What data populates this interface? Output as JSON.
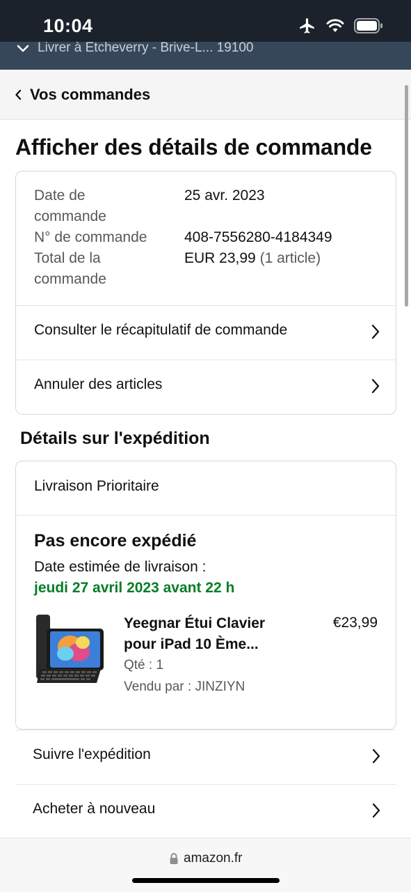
{
  "status_bar": {
    "time": "10:04"
  },
  "delivery_strip": {
    "text": "Livrer à Etcheverry - Brive-L... 19100"
  },
  "nav": {
    "back_label": "Vos commandes"
  },
  "page": {
    "title": "Afficher des détails de commande"
  },
  "order_summary": {
    "date_label_line1": "Date de",
    "date_label_line2": "commande",
    "date_value": "25 avr. 2023",
    "number_label": "N° de commande",
    "number_value": "408-7556280-4184349",
    "total_label_line1": "Total de la",
    "total_label_line2": "commande",
    "total_value": "EUR 23,99",
    "total_items": "(1 article)"
  },
  "summary_links": {
    "recap": "Consulter le récapitulatif de commande",
    "cancel": "Annuler des articles"
  },
  "shipment": {
    "section_title": "Détails sur l'expédition",
    "method": "Livraison Prioritaire",
    "status": "Pas encore expédié",
    "estimate_label": "Date estimée de livraison :",
    "estimate_date": "jeudi 27 avril 2023 avant 22 h",
    "product": {
      "title_line1": "Yeegnar Étui Clavier",
      "title_line2": "pour iPad 10 Ème...",
      "price": "€23,99",
      "quantity": "Qté : 1",
      "seller": "Vendu par : JINZIYN"
    }
  },
  "actions": {
    "track": "Suivre l'expédition",
    "buy_again": "Acheter à nouveau"
  },
  "browser": {
    "domain": "amazon.fr"
  },
  "colors": {
    "status_bar_bg": "#1b222b",
    "delivery_strip_bg": "#37475a",
    "estimate_green": "#067d26",
    "border": "#d5d9d9"
  }
}
